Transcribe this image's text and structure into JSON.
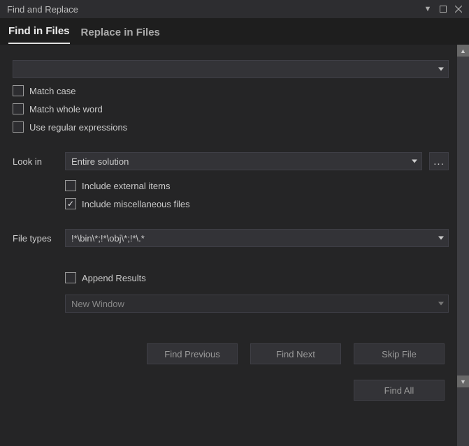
{
  "window": {
    "title": "Find and Replace"
  },
  "tabs": {
    "find": "Find in Files",
    "replace": "Replace in Files",
    "active": "find"
  },
  "search": {
    "value": ""
  },
  "options": {
    "matchCase": "Match case",
    "matchWord": "Match whole word",
    "useRegex": "Use regular expressions"
  },
  "lookIn": {
    "label": "Look in",
    "value": "Entire solution",
    "includeExternal": "Include external items",
    "includeMisc": "Include miscellaneous files",
    "includeMiscChecked": true
  },
  "fileTypes": {
    "label": "File types",
    "value": "!*\\bin\\*;!*\\obj\\*;!*\\.*"
  },
  "results": {
    "append": "Append Results",
    "window": "New Window"
  },
  "buttons": {
    "findPrev": "Find Previous",
    "findNext": "Find Next",
    "skip": "Skip File",
    "findAll": "Find All"
  }
}
